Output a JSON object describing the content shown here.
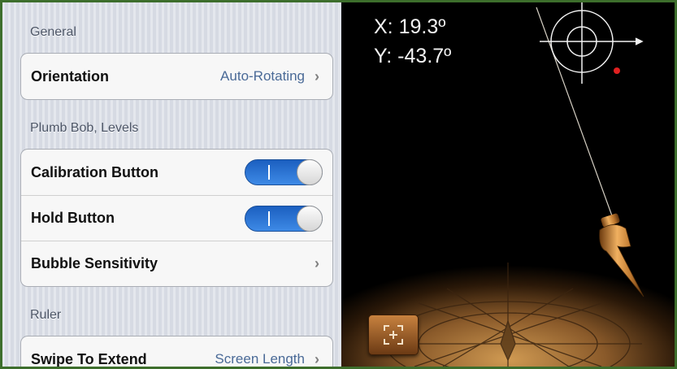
{
  "settings": {
    "general": {
      "header": "General",
      "orientation": {
        "label": "Orientation",
        "value": "Auto-Rotating"
      }
    },
    "plumb_bob": {
      "header": "Plumb Bob, Levels",
      "calibration_button": {
        "label": "Calibration Button",
        "state": "on"
      },
      "hold_button": {
        "label": "Hold Button",
        "state": "on"
      },
      "bubble_sensitivity": {
        "label": "Bubble Sensitivity"
      }
    },
    "ruler": {
      "header": "Ruler",
      "swipe_to_extend": {
        "label": "Swipe To Extend",
        "value": "Screen Length"
      }
    },
    "chevron": "›"
  },
  "scene": {
    "x_readout": "X: 19.3º",
    "y_readout": "Y: -43.7º"
  },
  "colors": {
    "border": "#3d6e2c",
    "toggle_on": "#2f7bd8",
    "value_text": "#4a6a97",
    "brass": "#c8853a"
  }
}
